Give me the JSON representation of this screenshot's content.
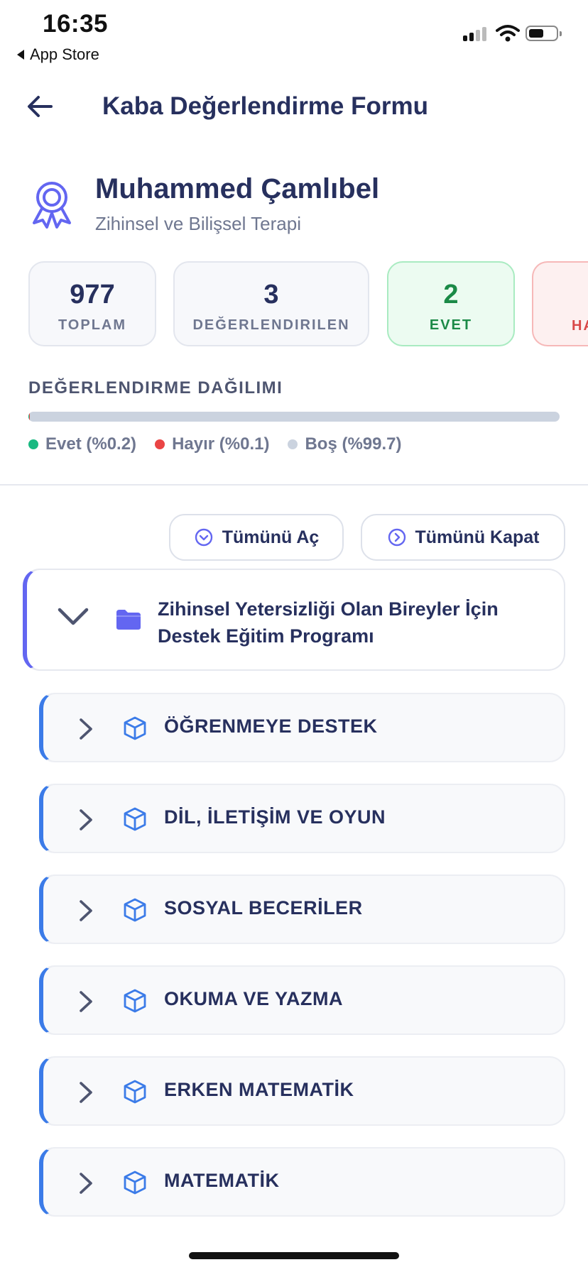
{
  "status_bar": {
    "time": "16:35",
    "back_app": "App Store"
  },
  "header": {
    "title": "Kaba Değerlendirme Formu"
  },
  "profile": {
    "name": "Muhammed Çamlıbel",
    "subtitle": "Zihinsel ve Bilişsel Terapi"
  },
  "stats": [
    {
      "value": "977",
      "label": "TOPLAM"
    },
    {
      "value": "3",
      "label": "DEĞERLENDIRILEN"
    },
    {
      "value": "2",
      "label": "EVET"
    },
    {
      "value": "",
      "label": "HA"
    }
  ],
  "distribution": {
    "title": "DEĞERLENDIRME DAĞILIMI",
    "yes_percent": 0.2,
    "no_percent": 0.1,
    "empty_percent": 99.7,
    "legend": {
      "yes": "Evet (%0.2)",
      "no": "Hayır (%0.1)",
      "empty": "Boş (%99.7)"
    },
    "colors": {
      "yes": "#19b981",
      "no": "#ea4545",
      "empty": "#cbd3df"
    }
  },
  "actions": {
    "expand_all": "Tümünü Aç",
    "collapse_all": "Tümünü Kapat"
  },
  "program": {
    "title_line1": "Zihinsel Yetersizliği Olan Bireyler İçin",
    "title_line2": "Destek Eğitim Programı"
  },
  "categories": [
    "ÖĞRENMEYE DESTEK",
    "DİL, İLETİŞİM VE OYUN",
    "SOSYAL BECERİLER",
    "OKUMA VE YAZMA",
    "ERKEN MATEMATİK",
    "MATEMATİK"
  ],
  "colors": {
    "primary_text": "#27305e",
    "accent_indigo": "#6366f1",
    "accent_blue": "#3b7be8"
  }
}
